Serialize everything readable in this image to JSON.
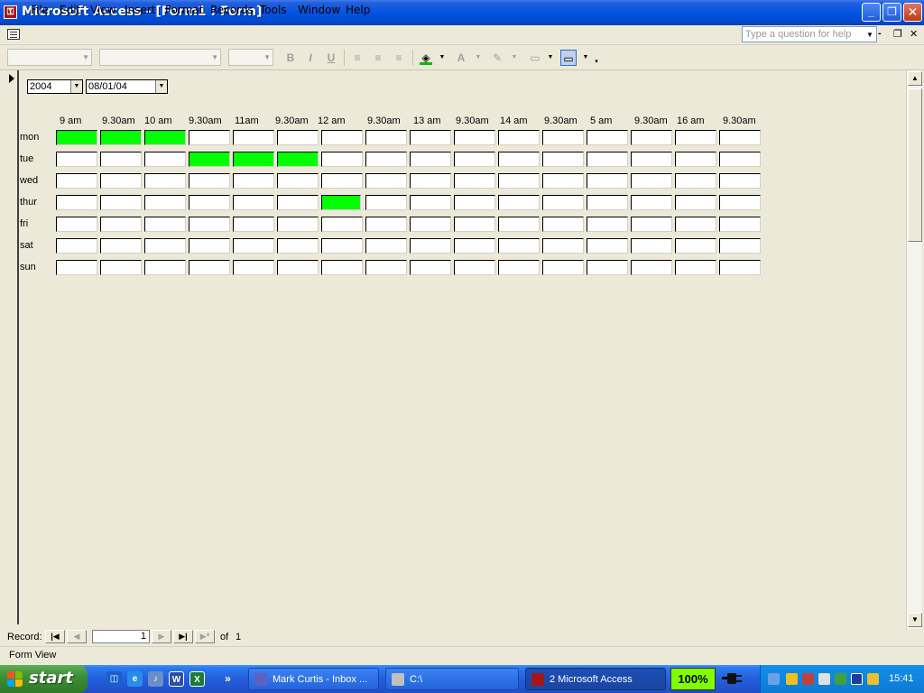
{
  "window": {
    "title": "Microsoft Access - [Form1 : Form]"
  },
  "menu": {
    "items": [
      "File",
      "Edit",
      "View",
      "Insert",
      "Format",
      "Records",
      "Tools",
      "Window",
      "Help"
    ],
    "help_placeholder": "Type a question for help"
  },
  "form": {
    "year_combo": "2004",
    "date_combo": "08/01/04",
    "columns": [
      "9 am",
      "9.30am",
      "10 am",
      "9.30am",
      "11am",
      "9.30am",
      "12 am",
      "9.30am",
      "13 am",
      "9.30am",
      "14 am",
      "9.30am",
      "5 am",
      "9.30am",
      "16 am",
      "9.30am"
    ],
    "rows": [
      {
        "label": "mon",
        "filled": [
          0,
          1,
          2
        ]
      },
      {
        "label": "tue",
        "filled": [
          3,
          4,
          5
        ]
      },
      {
        "label": "wed",
        "filled": []
      },
      {
        "label": "thur",
        "filled": [
          6
        ]
      },
      {
        "label": "fri",
        "filled": []
      },
      {
        "label": "sat",
        "filled": []
      },
      {
        "label": "sun",
        "filled": []
      }
    ],
    "filled_color": "#00FF00"
  },
  "record_nav": {
    "label": "Record:",
    "current": "1",
    "of_label": "of",
    "total": "1"
  },
  "status": {
    "text": "Form View"
  },
  "taskbar": {
    "start_label": "start",
    "items": [
      {
        "label": "Mark Curtis - Inbox ...",
        "active": false
      },
      {
        "label": "C:\\",
        "active": false
      },
      {
        "label": "2 Microsoft Access",
        "active": true
      }
    ],
    "zoom": "100%",
    "clock": "15:41"
  },
  "colors": {
    "titlebar": "#0054E3",
    "taskbar": "#245EDB",
    "start": "#3C8F34"
  }
}
